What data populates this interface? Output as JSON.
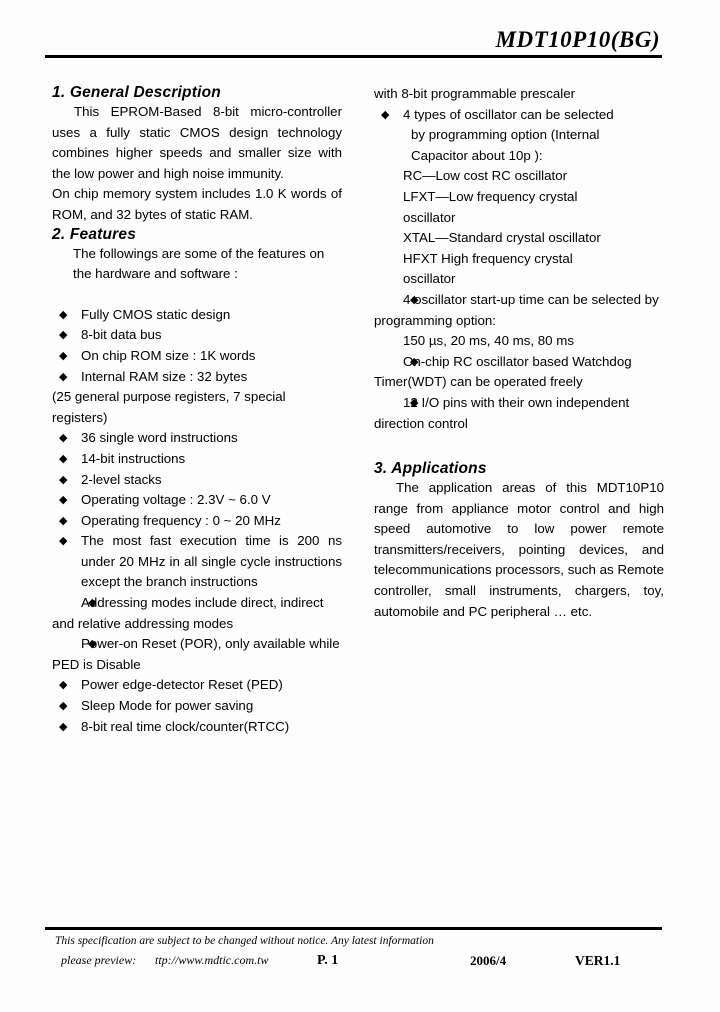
{
  "header": {
    "title": "MDT10P10(BG)"
  },
  "icons": {
    "bullet": "◆"
  },
  "left_column": {
    "section1": {
      "heading": "1. General Description",
      "paragraph1": "This EPROM-Based 8-bit micro-controller uses a fully static CMOS design technology combines higher speeds and smaller size with the low power and high noise immunity.",
      "paragraph2": "On chip memory system includes 1.0 K words of ROM, and 32 bytes of static RAM."
    },
    "section2": {
      "heading": "2. Features",
      "intro": "The followings are some of the features on the hardware and software :",
      "items": [
        "Fully CMOS static design",
        "8-bit data bus",
        "On chip ROM size : 1K words",
        "Internal RAM size : 32 bytes"
      ],
      "registers_note": "(25 general purpose registers, 7 special registers)",
      "items2": [
        "36 single word instructions",
        "14-bit instructions",
        "2-level stacks",
        "Operating voltage : 2.3V ~ 6.0 V",
        "Operating frequency : 0 ~ 20 MHz"
      ],
      "exec_time_item": "The most fast execution time is 200 ns under 20 MHz in all single cycle instructions except the branch instructions",
      "addressing_item": "Addressing modes include direct, indirect and relative addressing modes",
      "por_item": "Power-on Reset (POR), only available while PED is Disable",
      "items3": [
        "Power edge-detector Reset (PED)",
        "Sleep Mode for power saving",
        "8-bit real time clock/counter(RTCC)"
      ]
    }
  },
  "right_column": {
    "prescaler_cont": "with 8-bit programmable prescaler",
    "oscillator_item": {
      "line1": "4 types of oscillator can be selected",
      "line2": "by programming option (Internal",
      "line3": "Capacitor about   10p ):",
      "types": [
        "RC—Low cost RC oscillator",
        "LFXT—Low frequency crystal",
        "oscillator",
        "XTAL—Standard crystal oscillator",
        "HFXT   High frequency crystal",
        "oscillator"
      ]
    },
    "startup_item": "4 oscillator start-up time can be selected by programming option:",
    "startup_values": "150 µs, 20 ms, 40 ms, 80 ms",
    "wdt_item": "On-chip RC oscillator based Watchdog Timer(WDT) can be operated freely",
    "io_item": "12 I/O pins with their own independent direction control",
    "section3": {
      "heading": "3. Applications",
      "paragraph": "The application areas of this MDT10P10 range from appliance motor control and high speed automotive to low power remote transmitters/receivers, pointing devices, and telecommunications processors, such as Remote controller, small instruments, chargers, toy, automobile and PC peripheral … etc."
    }
  },
  "footer": {
    "disclaimer": "This specification are subject to be changed without notice. Any latest information",
    "preview_label": "please preview:",
    "url": "ttp://www.mdtic.com.tw",
    "page": "P. 1",
    "date": "2006/4",
    "version": "VER1.1"
  }
}
